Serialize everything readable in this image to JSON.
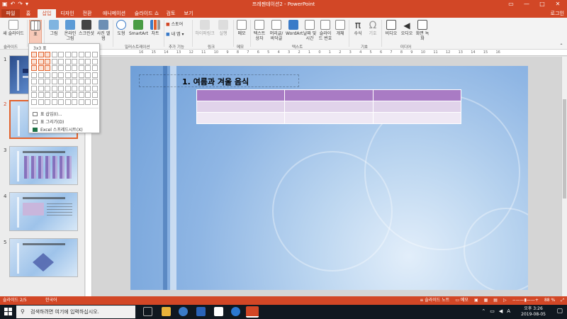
{
  "window": {
    "title": "프레젠테이션2 - PowerPoint",
    "login": "로그인"
  },
  "tabs": [
    "파일",
    "홈",
    "삽입",
    "디자인",
    "전환",
    "애니메이션",
    "슬라이드 쇼",
    "검토",
    "보기"
  ],
  "ribbon": {
    "new_slide": "새 슬라이드",
    "table": "표",
    "images": "그림",
    "online_images": "온라인 그림",
    "screenshot": "스크린샷",
    "photo_album": "사진 앨범",
    "shapes": "도형",
    "smartart": "SmartArt",
    "chart": "차트",
    "store": "스토어",
    "my_addins": "내 앱",
    "hyperlink": "하이퍼링크",
    "action": "실행",
    "comment": "메모",
    "textbox": "텍스트 상자",
    "header_footer": "머리글/바닥글",
    "wordart": "WordArt",
    "date_time": "날짜 및 시간",
    "slide_number": "슬라이드 번호",
    "object": "개체",
    "equation": "수식",
    "symbol": "기호",
    "video": "비디오",
    "audio": "오디오",
    "screen_recording": "화면 녹화",
    "groups": {
      "slides": "슬라이드",
      "illustrations": "일러스트레이션",
      "addins": "추가 기능",
      "links": "링크",
      "comments": "메모",
      "text": "텍스트",
      "symbols": "기호",
      "media": "미디어"
    }
  },
  "table_menu": {
    "header": "3x3 표",
    "selected_cols": 3,
    "selected_rows": 3,
    "grid_cols": 10,
    "grid_rows": 8,
    "items": [
      "표 삽입(I)...",
      "표 그리기(D)",
      "Excel 스프레드시트(X)"
    ]
  },
  "thumbnails": [
    {
      "num": "1",
      "title": "겨울 음식"
    },
    {
      "num": "2",
      "title": ""
    },
    {
      "num": "3",
      "title": "오늘의 겨울 음식 통계"
    },
    {
      "num": "4",
      "title": "표와 텍스트"
    },
    {
      "num": "5",
      "title": "SmartArt"
    }
  ],
  "slide": {
    "title": "1. 여름과 겨울 음식",
    "table": {
      "rows": 3,
      "cols": 3
    }
  },
  "ruler": {
    "ticks": [
      "16",
      "15",
      "14",
      "13",
      "12",
      "11",
      "10",
      "9",
      "8",
      "7",
      "6",
      "5",
      "4",
      "3",
      "2",
      "1",
      "0",
      "1",
      "2",
      "3",
      "4",
      "5",
      "6",
      "7",
      "8",
      "9",
      "10",
      "11",
      "12",
      "13",
      "14",
      "15",
      "16"
    ]
  },
  "status": {
    "slide_counter": "슬라이드 2/5",
    "language": "한국어",
    "notes": "슬라이드 노트",
    "comments": "메모",
    "zoom": "88 %"
  },
  "taskbar": {
    "search_placeholder": "검색하려면 여기에 입력하십시오.",
    "time": "오후 3:26",
    "date": "2019-08-05"
  },
  "colors": {
    "accent": "#d24726",
    "table_header": "#a97bc4",
    "table_row": "#e1d3ea"
  }
}
